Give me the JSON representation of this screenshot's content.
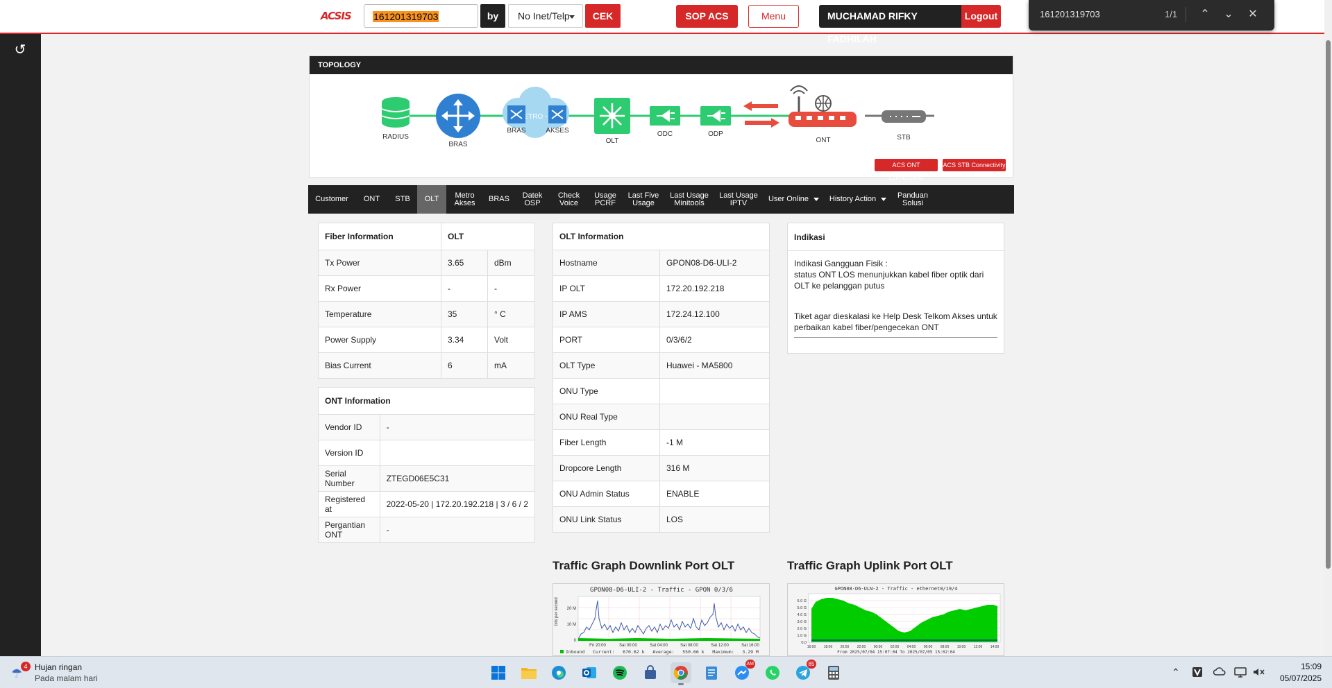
{
  "header": {
    "logo": "ACSIS",
    "search_value": "161201319703",
    "by_label": "by",
    "select_value": "No Inet/Telp",
    "cek_label": "CEK",
    "sop_label": "SOP ACS",
    "menu_label": "Menu",
    "user_name": "MUCHAMAD RIFKY FADHILAH",
    "logout_label": "Logout"
  },
  "find_bar": {
    "query": "161201319703",
    "count": "1/1"
  },
  "topology": {
    "title": "TOPOLOGY",
    "nodes": {
      "radius": "RADIUS",
      "bras": "BRAS",
      "bras2": "BRAS",
      "metro": "METRO - E",
      "akses": "AKSES",
      "olt": "OLT",
      "odc": "ODC",
      "odp": "ODP",
      "ont": "ONT",
      "stb": "STB"
    },
    "buttons": [
      "ACS ONT Connectivity",
      "ACS STB Connectivity"
    ]
  },
  "tabs": [
    "Customer",
    "ONT",
    "STB",
    "OLT",
    "Metro\nAkses",
    "BRAS",
    "Datek\nOSP",
    "Check\nVoice",
    "Usage\nPCRF",
    "Last Five\nUsage",
    "Last Usage\nMinitools",
    "Last Usage\nIPTV",
    "User Online",
    "History Action",
    "Panduan\nSolusi"
  ],
  "active_tab": "OLT",
  "fiber_info": {
    "header": [
      "Fiber Information",
      "OLT"
    ],
    "rows": [
      [
        "Tx Power",
        "3.65",
        "dBm"
      ],
      [
        "Rx Power",
        "-",
        "-"
      ],
      [
        "Temperature",
        "35",
        "° C"
      ],
      [
        "Power Supply",
        "3.34",
        "Volt"
      ],
      [
        "Bias Current",
        "6",
        "mA"
      ]
    ]
  },
  "ont_info": {
    "header": "ONT Information",
    "rows": [
      [
        "Vendor ID",
        "-"
      ],
      [
        "Version ID",
        ""
      ],
      [
        "Serial Number",
        "ZTEGD06E5C31"
      ],
      [
        "Registered at",
        "2022-05-20 | 172.20.192.218 | 3 / 6 / 2"
      ],
      [
        "Pergantian ONT",
        "-"
      ]
    ]
  },
  "olt_info": {
    "header": "OLT Information",
    "rows": [
      [
        "Hostname",
        "GPON08-D6-ULI-2"
      ],
      [
        "IP OLT",
        "172.20.192.218"
      ],
      [
        "IP AMS",
        "172.24.12.100"
      ],
      [
        "PORT",
        "0/3/6/2"
      ],
      [
        "OLT Type",
        "Huawei - MA5800"
      ],
      [
        "ONU Type",
        ""
      ],
      [
        "ONU Real Type",
        ""
      ],
      [
        "Fiber Length",
        "-1 M"
      ],
      [
        "Dropcore Length",
        "316 M"
      ],
      [
        "ONU Admin Status",
        "ENABLE"
      ],
      [
        "ONU Link Status",
        "LOS"
      ]
    ]
  },
  "indikasi": {
    "header": "Indikasi",
    "line1": "Indikasi Gangguan Fisik :",
    "line2": "status ONT LOS menunjukkan kabel fiber optik dari OLT ke pelanggan putus",
    "line3": "Tiket agar dieskalasi ke Help Desk Telkom Akses untuk perbaikan kabel fiber/pengecekan ONT"
  },
  "graphs": {
    "downlink_title": "Traffic Graph Downlink Port OLT",
    "uplink_title": "Traffic Graph Uplink Port OLT",
    "downlink_caption": "GPON08-D6-ULI-2 - Traffic - GPON 0/3/6",
    "uplink_caption": "GPON08-D6-ULN-2 - Traffic - ethernet0/19/4",
    "downlink_yaxis": "bits per second",
    "downlink_yticks": [
      "20 M",
      "10 M",
      "0"
    ],
    "downlink_xticks": [
      "Fri 20:00",
      "Sat 00:00",
      "Sat 04:00",
      "Sat 08:00",
      "Sat 12:00",
      "Sat 16:00"
    ],
    "downlink_legend": "Inbound   Current:   670.62 k   Average:   550.66 k   Maximum:   3.29 M",
    "uplink_yticks": [
      "6.0 G",
      "5.0 G",
      "4.0 G",
      "3.0 G",
      "2.0 G",
      "1.0 G",
      "0.0"
    ],
    "uplink_xticks": [
      "16:00",
      "18:00",
      "20:00",
      "22:00",
      "00:00",
      "02:00",
      "04:00",
      "06:00",
      "08:00",
      "10:00",
      "12:00",
      "14:00"
    ],
    "uplink_footer": "From 2025/07/04 15:07:04 To 2025/07/05 15:02:04"
  },
  "taskbar": {
    "weather_title": "Hujan ringan",
    "weather_sub": "Pada malam hari",
    "weather_badge": "4",
    "telegram_badge": "85",
    "time": "15:09",
    "date": "05/07/2025"
  },
  "colors": {
    "accent_red": "#d62828",
    "dark": "#222222",
    "node_green": "#2ecc71",
    "node_blue": "#2f80d1"
  }
}
